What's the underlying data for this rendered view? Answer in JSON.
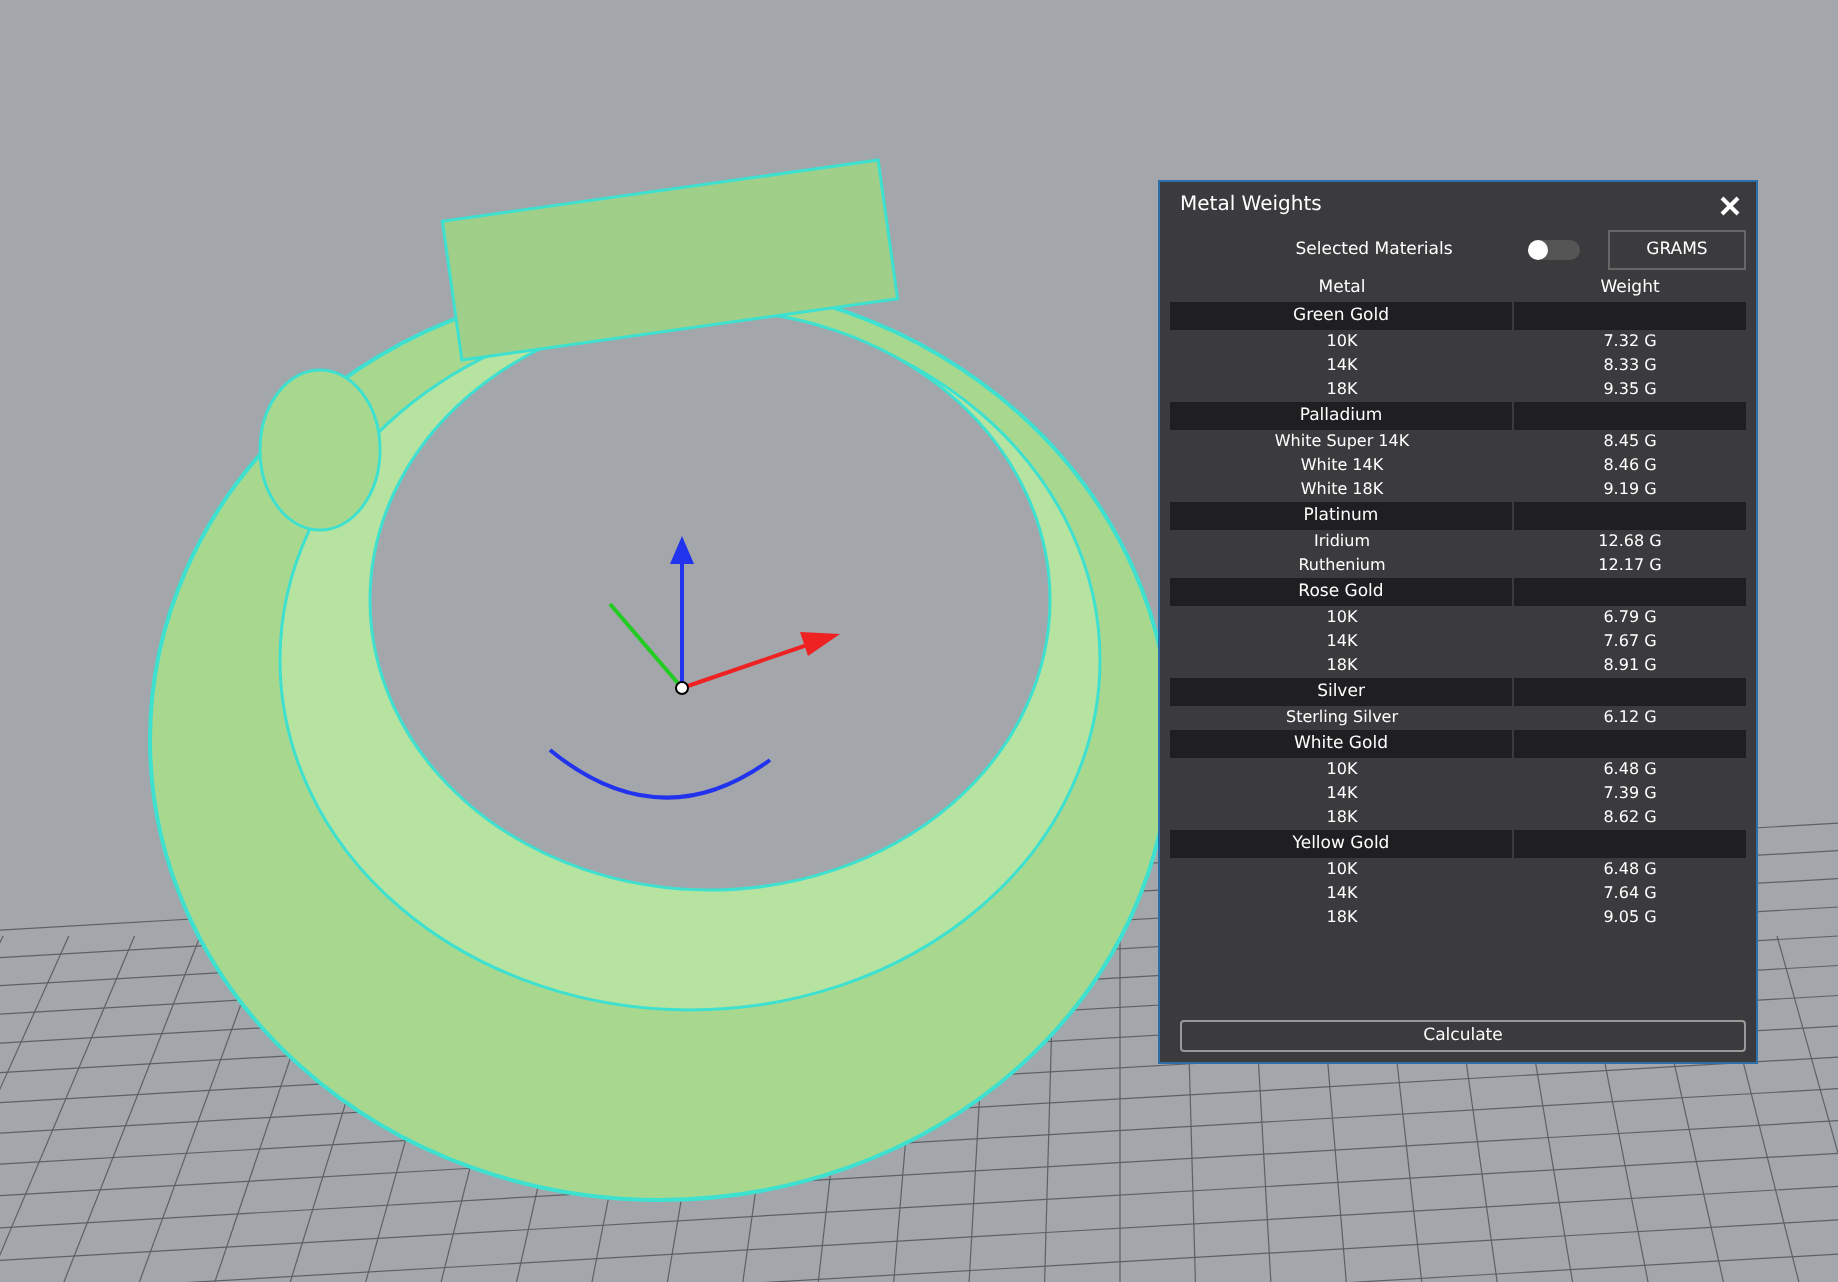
{
  "panel": {
    "title": "Metal Weights",
    "selected_materials": {
      "label": "Selected Materials",
      "on": false
    },
    "unit_button": "GRAMS",
    "columns": [
      "Metal",
      "Weight"
    ],
    "groups": [
      {
        "name": "Green Gold",
        "items": [
          {
            "metal": "10K",
            "weight": "7.32 G"
          },
          {
            "metal": "14K",
            "weight": "8.33 G"
          },
          {
            "metal": "18K",
            "weight": "9.35 G"
          }
        ]
      },
      {
        "name": "Palladium",
        "items": [
          {
            "metal": "White Super 14K",
            "weight": "8.45 G"
          },
          {
            "metal": "White 14K",
            "weight": "8.46 G"
          },
          {
            "metal": "White 18K",
            "weight": "9.19 G"
          }
        ]
      },
      {
        "name": "Platinum",
        "items": [
          {
            "metal": "Iridium",
            "weight": "12.68 G"
          },
          {
            "metal": "Ruthenium",
            "weight": "12.17 G"
          }
        ]
      },
      {
        "name": "Rose Gold",
        "items": [
          {
            "metal": "10K",
            "weight": "6.79 G"
          },
          {
            "metal": "14K",
            "weight": "7.67 G"
          },
          {
            "metal": "18K",
            "weight": "8.91 G"
          }
        ]
      },
      {
        "name": "Silver",
        "items": [
          {
            "metal": "Sterling Silver",
            "weight": "6.12 G"
          }
        ]
      },
      {
        "name": "White Gold",
        "items": [
          {
            "metal": "10K",
            "weight": "6.48 G"
          },
          {
            "metal": "14K",
            "weight": "7.39 G"
          },
          {
            "metal": "18K",
            "weight": "8.62 G"
          }
        ]
      },
      {
        "name": "Yellow Gold",
        "items": [
          {
            "metal": "10K",
            "weight": "6.48 G"
          },
          {
            "metal": "14K",
            "weight": "7.64 G"
          },
          {
            "metal": "18K",
            "weight": "9.05 G"
          }
        ]
      }
    ],
    "action_button": "Calculate"
  }
}
